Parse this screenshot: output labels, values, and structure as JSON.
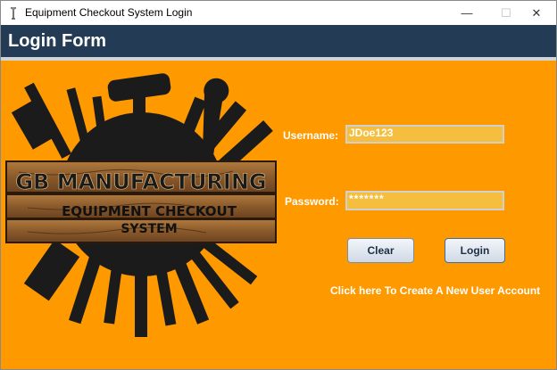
{
  "window": {
    "title": "Equipment Checkout System Login",
    "minimize_glyph": "—",
    "maximize_glyph": "☐",
    "close_glyph": "✕"
  },
  "header": {
    "title": "Login Form"
  },
  "logo": {
    "line1": "GB MANUFACTURING",
    "line2": "EQUIPMENT CHECKOUT",
    "line3": "SYSTEM"
  },
  "form": {
    "username_label": "Username:",
    "username_value": "JDoe123",
    "password_label": "Password:",
    "password_value": "*******",
    "clear_label": "Clear",
    "login_label": "Login",
    "create_account_link": "Click here To Create A New User Account"
  },
  "colors": {
    "background": "#ff9900",
    "header": "#243b55",
    "field": "#f6be3e"
  },
  "icons": [
    "java-app-icon",
    "tools-emblem-icon"
  ]
}
